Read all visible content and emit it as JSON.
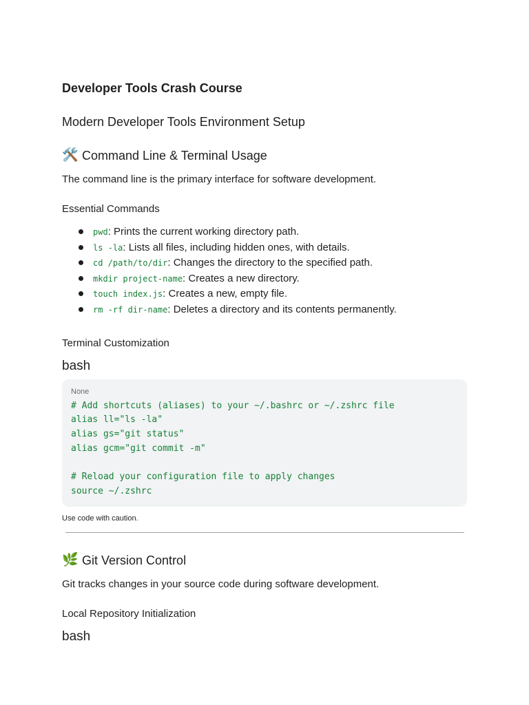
{
  "document": {
    "title": "Developer Tools Crash Course",
    "subtitle": "Modern Developer Tools Environment Setup"
  },
  "section_cli": {
    "icon": "hammer-and-wrench-icon",
    "emoji": "🛠️",
    "heading": "Command Line & Terminal Usage",
    "intro": "The command line is the primary interface for software development.",
    "essential_heading": "Essential Commands",
    "commands": [
      {
        "code": "pwd",
        "desc": ": Prints the current working directory path."
      },
      {
        "code": "ls -la",
        "desc": ": Lists all files, including hidden ones, with details."
      },
      {
        "code": "cd /path/to/dir",
        "desc": ": Changes the directory to the specified path."
      },
      {
        "code": "mkdir project-name",
        "desc": ": Creates a new directory."
      },
      {
        "code": "touch index.js",
        "desc": ": Creates a new, empty file."
      },
      {
        "code": "rm -rf dir-name",
        "desc": ": Deletes a directory and its contents permanently."
      }
    ],
    "customization_heading": "Terminal Customization",
    "code_language": "bash",
    "code_block": {
      "lang_tag": "None",
      "lines": [
        "# Add shortcuts (aliases) to your ~/.bashrc or ~/.zshrc file",
        "alias ll=\"ls -la\"",
        "alias gs=\"git status\"",
        "alias gcm=\"git commit -m\"",
        "",
        "# Reload your configuration file to apply changes",
        "source ~/.zshrc"
      ]
    },
    "caution": "Use code with caution."
  },
  "section_git": {
    "icon": "herb-icon",
    "emoji": "🌿",
    "heading": "Git Version Control",
    "intro": "Git tracks changes in your source code during software development.",
    "local_heading": "Local Repository Initialization",
    "code_language": "bash"
  },
  "colors": {
    "code_text": "#188038",
    "code_bg": "#f1f3f4",
    "text": "#1f1f1f"
  }
}
